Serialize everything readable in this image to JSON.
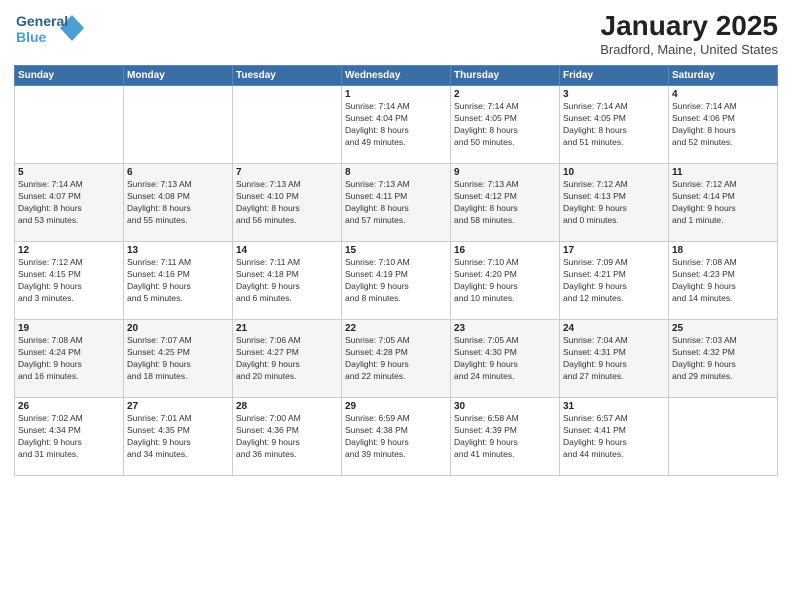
{
  "logo": {
    "line1": "General",
    "line2": "Blue"
  },
  "title": "January 2025",
  "location": "Bradford, Maine, United States",
  "weekdays": [
    "Sunday",
    "Monday",
    "Tuesday",
    "Wednesday",
    "Thursday",
    "Friday",
    "Saturday"
  ],
  "weeks": [
    [
      {
        "day": "",
        "info": ""
      },
      {
        "day": "",
        "info": ""
      },
      {
        "day": "",
        "info": ""
      },
      {
        "day": "1",
        "info": "Sunrise: 7:14 AM\nSunset: 4:04 PM\nDaylight: 8 hours\nand 49 minutes."
      },
      {
        "day": "2",
        "info": "Sunrise: 7:14 AM\nSunset: 4:05 PM\nDaylight: 8 hours\nand 50 minutes."
      },
      {
        "day": "3",
        "info": "Sunrise: 7:14 AM\nSunset: 4:05 PM\nDaylight: 8 hours\nand 51 minutes."
      },
      {
        "day": "4",
        "info": "Sunrise: 7:14 AM\nSunset: 4:06 PM\nDaylight: 8 hours\nand 52 minutes."
      }
    ],
    [
      {
        "day": "5",
        "info": "Sunrise: 7:14 AM\nSunset: 4:07 PM\nDaylight: 8 hours\nand 53 minutes."
      },
      {
        "day": "6",
        "info": "Sunrise: 7:13 AM\nSunset: 4:08 PM\nDaylight: 8 hours\nand 55 minutes."
      },
      {
        "day": "7",
        "info": "Sunrise: 7:13 AM\nSunset: 4:10 PM\nDaylight: 8 hours\nand 56 minutes."
      },
      {
        "day": "8",
        "info": "Sunrise: 7:13 AM\nSunset: 4:11 PM\nDaylight: 8 hours\nand 57 minutes."
      },
      {
        "day": "9",
        "info": "Sunrise: 7:13 AM\nSunset: 4:12 PM\nDaylight: 8 hours\nand 58 minutes."
      },
      {
        "day": "10",
        "info": "Sunrise: 7:12 AM\nSunset: 4:13 PM\nDaylight: 9 hours\nand 0 minutes."
      },
      {
        "day": "11",
        "info": "Sunrise: 7:12 AM\nSunset: 4:14 PM\nDaylight: 9 hours\nand 1 minute."
      }
    ],
    [
      {
        "day": "12",
        "info": "Sunrise: 7:12 AM\nSunset: 4:15 PM\nDaylight: 9 hours\nand 3 minutes."
      },
      {
        "day": "13",
        "info": "Sunrise: 7:11 AM\nSunset: 4:16 PM\nDaylight: 9 hours\nand 5 minutes."
      },
      {
        "day": "14",
        "info": "Sunrise: 7:11 AM\nSunset: 4:18 PM\nDaylight: 9 hours\nand 6 minutes."
      },
      {
        "day": "15",
        "info": "Sunrise: 7:10 AM\nSunset: 4:19 PM\nDaylight: 9 hours\nand 8 minutes."
      },
      {
        "day": "16",
        "info": "Sunrise: 7:10 AM\nSunset: 4:20 PM\nDaylight: 9 hours\nand 10 minutes."
      },
      {
        "day": "17",
        "info": "Sunrise: 7:09 AM\nSunset: 4:21 PM\nDaylight: 9 hours\nand 12 minutes."
      },
      {
        "day": "18",
        "info": "Sunrise: 7:08 AM\nSunset: 4:23 PM\nDaylight: 9 hours\nand 14 minutes."
      }
    ],
    [
      {
        "day": "19",
        "info": "Sunrise: 7:08 AM\nSunset: 4:24 PM\nDaylight: 9 hours\nand 16 minutes."
      },
      {
        "day": "20",
        "info": "Sunrise: 7:07 AM\nSunset: 4:25 PM\nDaylight: 9 hours\nand 18 minutes."
      },
      {
        "day": "21",
        "info": "Sunrise: 7:06 AM\nSunset: 4:27 PM\nDaylight: 9 hours\nand 20 minutes."
      },
      {
        "day": "22",
        "info": "Sunrise: 7:05 AM\nSunset: 4:28 PM\nDaylight: 9 hours\nand 22 minutes."
      },
      {
        "day": "23",
        "info": "Sunrise: 7:05 AM\nSunset: 4:30 PM\nDaylight: 9 hours\nand 24 minutes."
      },
      {
        "day": "24",
        "info": "Sunrise: 7:04 AM\nSunset: 4:31 PM\nDaylight: 9 hours\nand 27 minutes."
      },
      {
        "day": "25",
        "info": "Sunrise: 7:03 AM\nSunset: 4:32 PM\nDaylight: 9 hours\nand 29 minutes."
      }
    ],
    [
      {
        "day": "26",
        "info": "Sunrise: 7:02 AM\nSunset: 4:34 PM\nDaylight: 9 hours\nand 31 minutes."
      },
      {
        "day": "27",
        "info": "Sunrise: 7:01 AM\nSunset: 4:35 PM\nDaylight: 9 hours\nand 34 minutes."
      },
      {
        "day": "28",
        "info": "Sunrise: 7:00 AM\nSunset: 4:36 PM\nDaylight: 9 hours\nand 36 minutes."
      },
      {
        "day": "29",
        "info": "Sunrise: 6:59 AM\nSunset: 4:38 PM\nDaylight: 9 hours\nand 39 minutes."
      },
      {
        "day": "30",
        "info": "Sunrise: 6:58 AM\nSunset: 4:39 PM\nDaylight: 9 hours\nand 41 minutes."
      },
      {
        "day": "31",
        "info": "Sunrise: 6:57 AM\nSunset: 4:41 PM\nDaylight: 9 hours\nand 44 minutes."
      },
      {
        "day": "",
        "info": ""
      }
    ]
  ]
}
